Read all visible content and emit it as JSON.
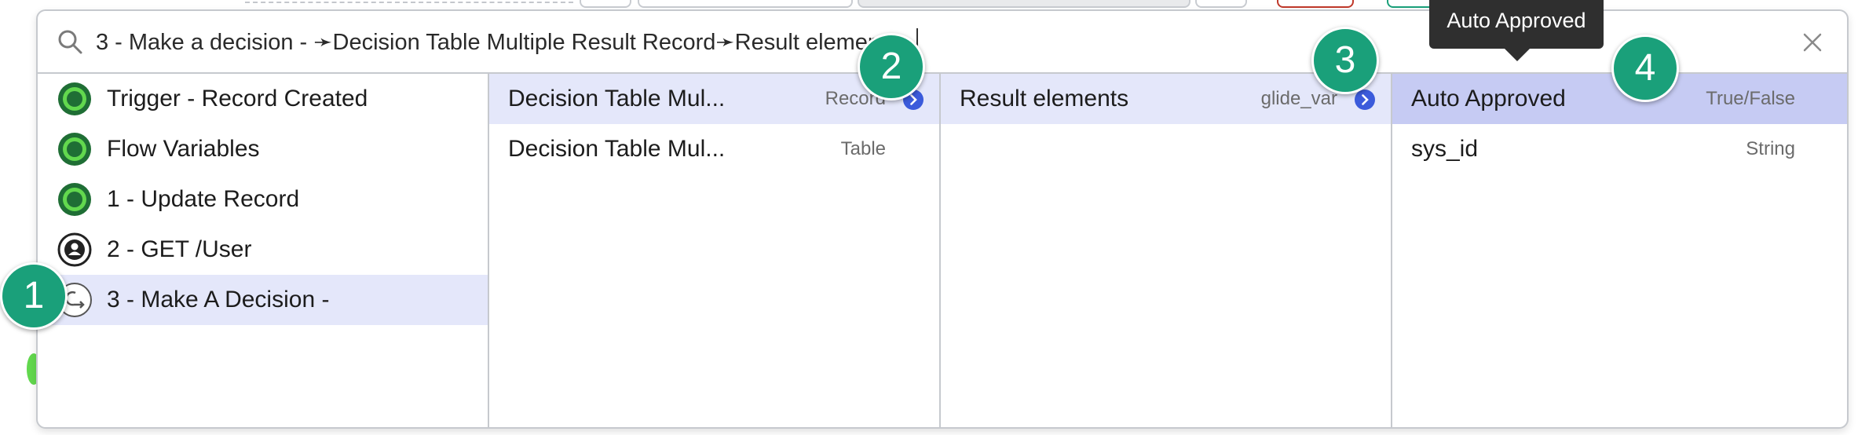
{
  "search": {
    "value": "3 - Make a decision - ➛Decision Table Multiple Result Record➛Result elements"
  },
  "tooltip": {
    "text": "Auto Approved"
  },
  "callouts": [
    "1",
    "2",
    "3",
    "4"
  ],
  "columns": {
    "steps": [
      {
        "label": "Trigger - Record Created",
        "icon": "trigger-icon"
      },
      {
        "label": "Flow Variables",
        "icon": "flow-variables-icon"
      },
      {
        "label": "1 - Update Record",
        "icon": "update-record-icon"
      },
      {
        "label": "2 - GET /User",
        "icon": "rest-step-icon"
      },
      {
        "label": "3 - Make A Decision -",
        "icon": "decision-icon",
        "selected": true
      }
    ],
    "records": [
      {
        "label": "Decision Table Mul...",
        "type": "Record",
        "selected": true,
        "has_children": true
      },
      {
        "label": "Decision Table Mul...",
        "type": "Table"
      }
    ],
    "elements": [
      {
        "label": "Result elements",
        "type": "glide_var",
        "selected": true,
        "has_children": true
      }
    ],
    "fields": [
      {
        "label": "Auto Approved",
        "type": "True/False",
        "selected": true
      },
      {
        "label": "sys_id",
        "type": "String"
      }
    ]
  },
  "colors": {
    "accent": "#3b5bdb",
    "selection": "#e4e7fa",
    "selection_strong": "#c6cbf3",
    "callout": "#1aa07a",
    "step_icon_green": "#62d84e",
    "tooltip_bg": "#2f2f2f"
  }
}
